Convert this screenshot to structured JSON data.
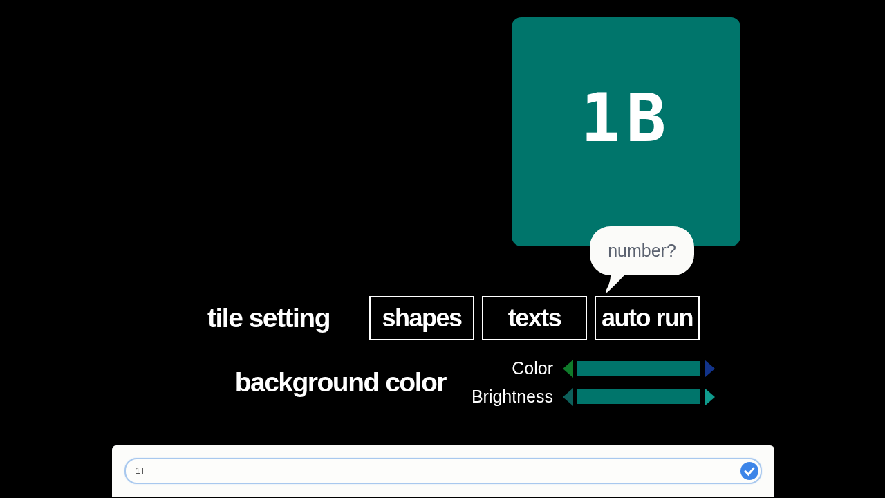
{
  "tile": {
    "label": "1B",
    "color": "#00756b"
  },
  "bubble": {
    "text": "number?"
  },
  "tile_setting": {
    "label": "tile setting",
    "buttons": [
      "shapes",
      "texts",
      "auto run"
    ]
  },
  "color_groups": [
    {
      "label": "background color",
      "sliders": [
        {
          "label": "Color",
          "color": "#00756b"
        },
        {
          "label": "Brightness",
          "color": "#00756b"
        }
      ]
    }
  ],
  "answer": {
    "value": "1T"
  }
}
